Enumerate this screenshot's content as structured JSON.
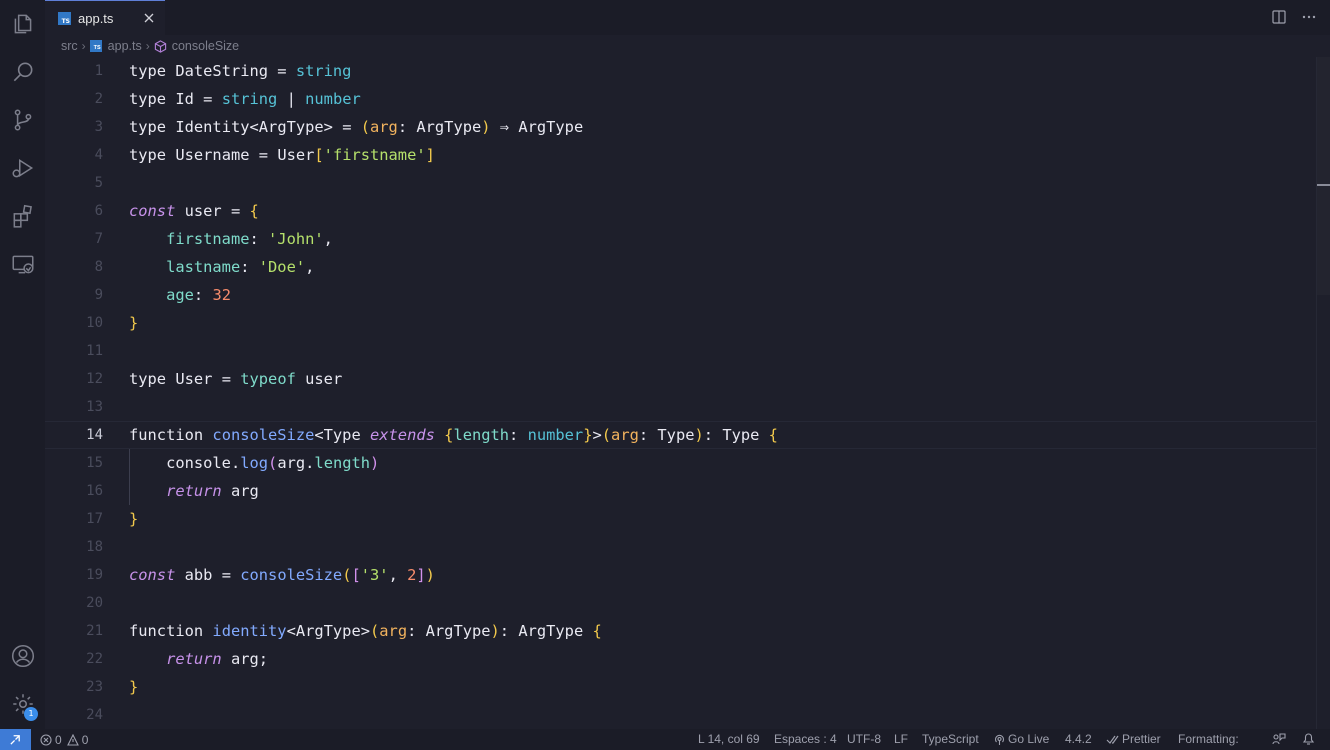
{
  "colors": {
    "editor_bg": "#1e1f2b",
    "sidebar_bg": "#1b1c27",
    "accent": "#3e7bd6",
    "keyword": "#c792ea",
    "function": "#82aaff",
    "type_builtin": "#56c2d6",
    "string": "#b5e06b",
    "number": "#f78c6c",
    "bracket": "#f2c94c"
  },
  "activity_bar": {
    "items": [
      {
        "name": "explorer-icon"
      },
      {
        "name": "search-icon"
      },
      {
        "name": "source-control-icon"
      },
      {
        "name": "run-debug-icon"
      },
      {
        "name": "extensions-icon"
      },
      {
        "name": "remote-explorer-icon"
      }
    ],
    "bottom": [
      {
        "name": "accounts-icon"
      },
      {
        "name": "manage-gear-icon",
        "badge": "1"
      }
    ]
  },
  "tab": {
    "icon_text": "TS",
    "label": "app.ts"
  },
  "breadcrumb": {
    "folder": "src",
    "file": "app.ts",
    "symbol": "consoleSize"
  },
  "editor": {
    "active_line": 14,
    "line_numbers": [
      "1",
      "2",
      "3",
      "4",
      "5",
      "6",
      "7",
      "8",
      "9",
      "10",
      "11",
      "12",
      "13",
      "14",
      "15",
      "16",
      "17",
      "18",
      "19",
      "20",
      "21",
      "22",
      "23",
      "24"
    ],
    "lines": [
      [
        [
          "k",
          "type"
        ],
        [
          "o",
          " "
        ],
        [
          "t",
          "DateString"
        ],
        [
          "o",
          " = "
        ],
        [
          "bt",
          "string"
        ]
      ],
      [
        [
          "k",
          "type"
        ],
        [
          "o",
          " "
        ],
        [
          "t",
          "Id"
        ],
        [
          "o",
          " = "
        ],
        [
          "bt",
          "string"
        ],
        [
          "o",
          " | "
        ],
        [
          "bt",
          "number"
        ]
      ],
      [
        [
          "k",
          "type"
        ],
        [
          "o",
          " "
        ],
        [
          "t",
          "Identity"
        ],
        [
          "o",
          "<"
        ],
        [
          "t",
          "ArgType"
        ],
        [
          "o",
          "> = "
        ],
        [
          "p",
          "("
        ],
        [
          "pa",
          "arg"
        ],
        [
          "o",
          ": "
        ],
        [
          "t",
          "ArgType"
        ],
        [
          "p",
          ")"
        ],
        [
          "o",
          " ⇒ "
        ],
        [
          "t",
          "ArgType"
        ]
      ],
      [
        [
          "k",
          "type"
        ],
        [
          "o",
          " "
        ],
        [
          "t",
          "Username"
        ],
        [
          "o",
          " = "
        ],
        [
          "t",
          "User"
        ],
        [
          "p",
          "["
        ],
        [
          "s",
          "'firstname'"
        ],
        [
          "p",
          "]"
        ]
      ],
      [],
      [
        [
          "kc",
          "const"
        ],
        [
          "o",
          " "
        ],
        [
          "v",
          "user"
        ],
        [
          "o",
          " = "
        ],
        [
          "p",
          "{"
        ]
      ],
      [
        [
          "o",
          "    "
        ],
        [
          "pr",
          "firstname"
        ],
        [
          "o",
          ": "
        ],
        [
          "s",
          "'John'"
        ],
        [
          "o",
          ","
        ]
      ],
      [
        [
          "o",
          "    "
        ],
        [
          "pr",
          "lastname"
        ],
        [
          "o",
          ": "
        ],
        [
          "s",
          "'Doe'"
        ],
        [
          "o",
          ","
        ]
      ],
      [
        [
          "o",
          "    "
        ],
        [
          "pr",
          "age"
        ],
        [
          "o",
          ": "
        ],
        [
          "n",
          "32"
        ]
      ],
      [
        [
          "p",
          "}"
        ]
      ],
      [],
      [
        [
          "k",
          "type"
        ],
        [
          "o",
          " "
        ],
        [
          "t",
          "User"
        ],
        [
          "o",
          " = "
        ],
        [
          "pr",
          "typeof"
        ],
        [
          "o",
          " "
        ],
        [
          "v",
          "user"
        ]
      ],
      [],
      [
        [
          "k",
          "function"
        ],
        [
          "o",
          " "
        ],
        [
          "f",
          "consoleSize"
        ],
        [
          "o",
          "<"
        ],
        [
          "t",
          "Type"
        ],
        [
          "o",
          " "
        ],
        [
          "kc",
          "extends"
        ],
        [
          "o",
          " "
        ],
        [
          "p",
          "{"
        ],
        [
          "pr",
          "length"
        ],
        [
          "o",
          ": "
        ],
        [
          "bt",
          "number"
        ],
        [
          "p",
          "}"
        ],
        [
          "o",
          ">"
        ],
        [
          "p",
          "("
        ],
        [
          "pa",
          "arg"
        ],
        [
          "o",
          ": "
        ],
        [
          "t",
          "Type"
        ],
        [
          "p",
          ")"
        ],
        [
          "o",
          ": "
        ],
        [
          "t",
          "Type"
        ],
        [
          "o",
          " "
        ],
        [
          "p",
          "{"
        ]
      ],
      [
        [
          "o",
          "    "
        ],
        [
          "v",
          "console"
        ],
        [
          "o",
          "."
        ],
        [
          "f",
          "log"
        ],
        [
          "pp",
          "("
        ],
        [
          "v",
          "arg"
        ],
        [
          "o",
          "."
        ],
        [
          "pr",
          "length"
        ],
        [
          "pp",
          ")"
        ]
      ],
      [
        [
          "o",
          "    "
        ],
        [
          "kc",
          "return"
        ],
        [
          "o",
          " "
        ],
        [
          "v",
          "arg"
        ]
      ],
      [
        [
          "p",
          "}"
        ]
      ],
      [],
      [
        [
          "kc",
          "const"
        ],
        [
          "o",
          " "
        ],
        [
          "v",
          "abb"
        ],
        [
          "o",
          " = "
        ],
        [
          "f",
          "consoleSize"
        ],
        [
          "p",
          "("
        ],
        [
          "pp",
          "["
        ],
        [
          "s",
          "'3'"
        ],
        [
          "o",
          ", "
        ],
        [
          "n",
          "2"
        ],
        [
          "pp",
          "]"
        ],
        [
          "p",
          ")"
        ]
      ],
      [],
      [
        [
          "k",
          "function"
        ],
        [
          "o",
          " "
        ],
        [
          "f",
          "identity"
        ],
        [
          "o",
          "<"
        ],
        [
          "t",
          "ArgType"
        ],
        [
          "o",
          ">"
        ],
        [
          "p",
          "("
        ],
        [
          "pa",
          "arg"
        ],
        [
          "o",
          ": "
        ],
        [
          "t",
          "ArgType"
        ],
        [
          "p",
          ")"
        ],
        [
          "o",
          ": "
        ],
        [
          "t",
          "ArgType"
        ],
        [
          "o",
          " "
        ],
        [
          "p",
          "{"
        ]
      ],
      [
        [
          "o",
          "    "
        ],
        [
          "kc",
          "return"
        ],
        [
          "o",
          " "
        ],
        [
          "v",
          "arg"
        ],
        [
          "o",
          ";"
        ]
      ],
      [
        [
          "p",
          "}"
        ]
      ],
      []
    ]
  },
  "status_bar": {
    "errors": "0",
    "warnings": "0",
    "position": "L 14, col 69",
    "spaces": "Espaces : 4",
    "encoding": "UTF-8",
    "eol": "LF",
    "language": "TypeScript",
    "go_live": "Go Live",
    "ts_version": "4.4.2",
    "prettier": "Prettier",
    "formatting": "Formatting:"
  }
}
